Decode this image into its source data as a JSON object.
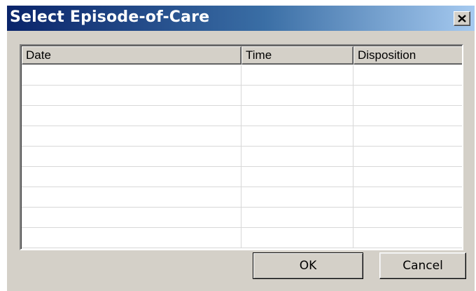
{
  "window": {
    "title": "Select Episode-of-Care",
    "close_icon": "close-icon"
  },
  "table": {
    "columns": [
      "Date",
      "Time",
      "Disposition"
    ],
    "rows": [
      [
        "",
        "",
        ""
      ],
      [
        "",
        "",
        ""
      ],
      [
        "",
        "",
        ""
      ],
      [
        "",
        "",
        ""
      ],
      [
        "",
        "",
        ""
      ],
      [
        "",
        "",
        ""
      ],
      [
        "",
        "",
        ""
      ],
      [
        "",
        "",
        ""
      ],
      [
        "",
        "",
        ""
      ]
    ]
  },
  "buttons": {
    "ok_label": "OK",
    "cancel_label": "Cancel"
  },
  "colors": {
    "titlebar_start": "#0a246a",
    "titlebar_end": "#a6caf0",
    "face": "#d4d0c8"
  }
}
